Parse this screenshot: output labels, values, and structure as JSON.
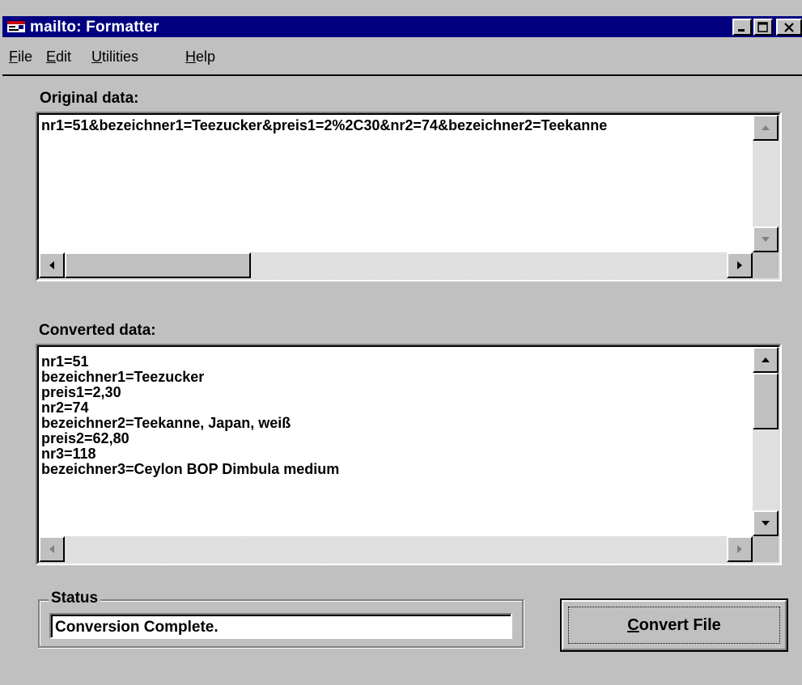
{
  "window": {
    "title": "mailto: Formatter",
    "controls": [
      "minimize",
      "maximize",
      "close"
    ]
  },
  "menu": [
    {
      "accel": "F",
      "rest": "ile"
    },
    {
      "accel": "E",
      "rest": "dit"
    },
    {
      "accel": "U",
      "rest": "tilities"
    },
    {
      "accel": "H",
      "rest": "elp"
    }
  ],
  "original": {
    "label": "Original data:",
    "text": "nr1=51&bezeichner1=Teezucker&preis1=2%2C30&nr2=74&bezeichner2=Teekanne"
  },
  "converted": {
    "label": "Converted data:",
    "text": "nr1=51\nbezeichner1=Teezucker\npreis1=2,30\nnr2=74\nbezeichner2=Teekanne, Japan, weiß\npreis2=62,80\nnr3=118\nbezeichner3=Ceylon BOP Dimbula medium"
  },
  "status": {
    "label": "Status",
    "value": "Conversion Complete."
  },
  "convert_button": {
    "accel": "C",
    "rest": "onvert File"
  },
  "colors": {
    "titlebar": "#000080",
    "face": "#c0c0c0"
  },
  "icons": [
    "app-icon",
    "minimize-icon",
    "maximize-icon",
    "close-icon",
    "arrow-up-icon",
    "arrow-down-icon",
    "arrow-left-icon",
    "arrow-right-icon"
  ]
}
